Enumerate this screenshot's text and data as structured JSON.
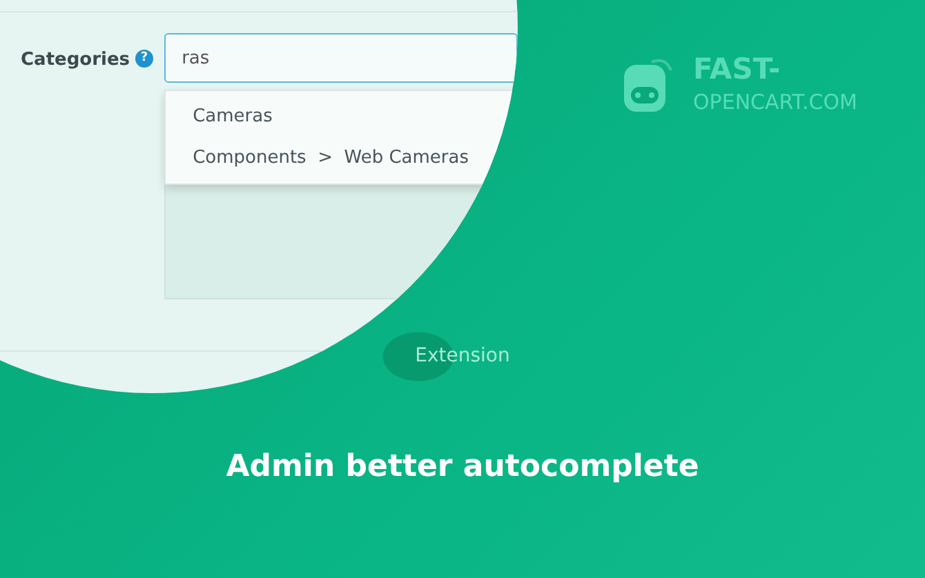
{
  "form": {
    "label": "Categories",
    "help": "?",
    "input_value": "ras",
    "suggestions": [
      "Cameras",
      "Components  >  Web Cameras"
    ]
  },
  "logo": {
    "line_1": "FAST-",
    "line_2": "OPENCART.COM"
  },
  "tag": "Extension",
  "title": "Admin better autocomplete"
}
